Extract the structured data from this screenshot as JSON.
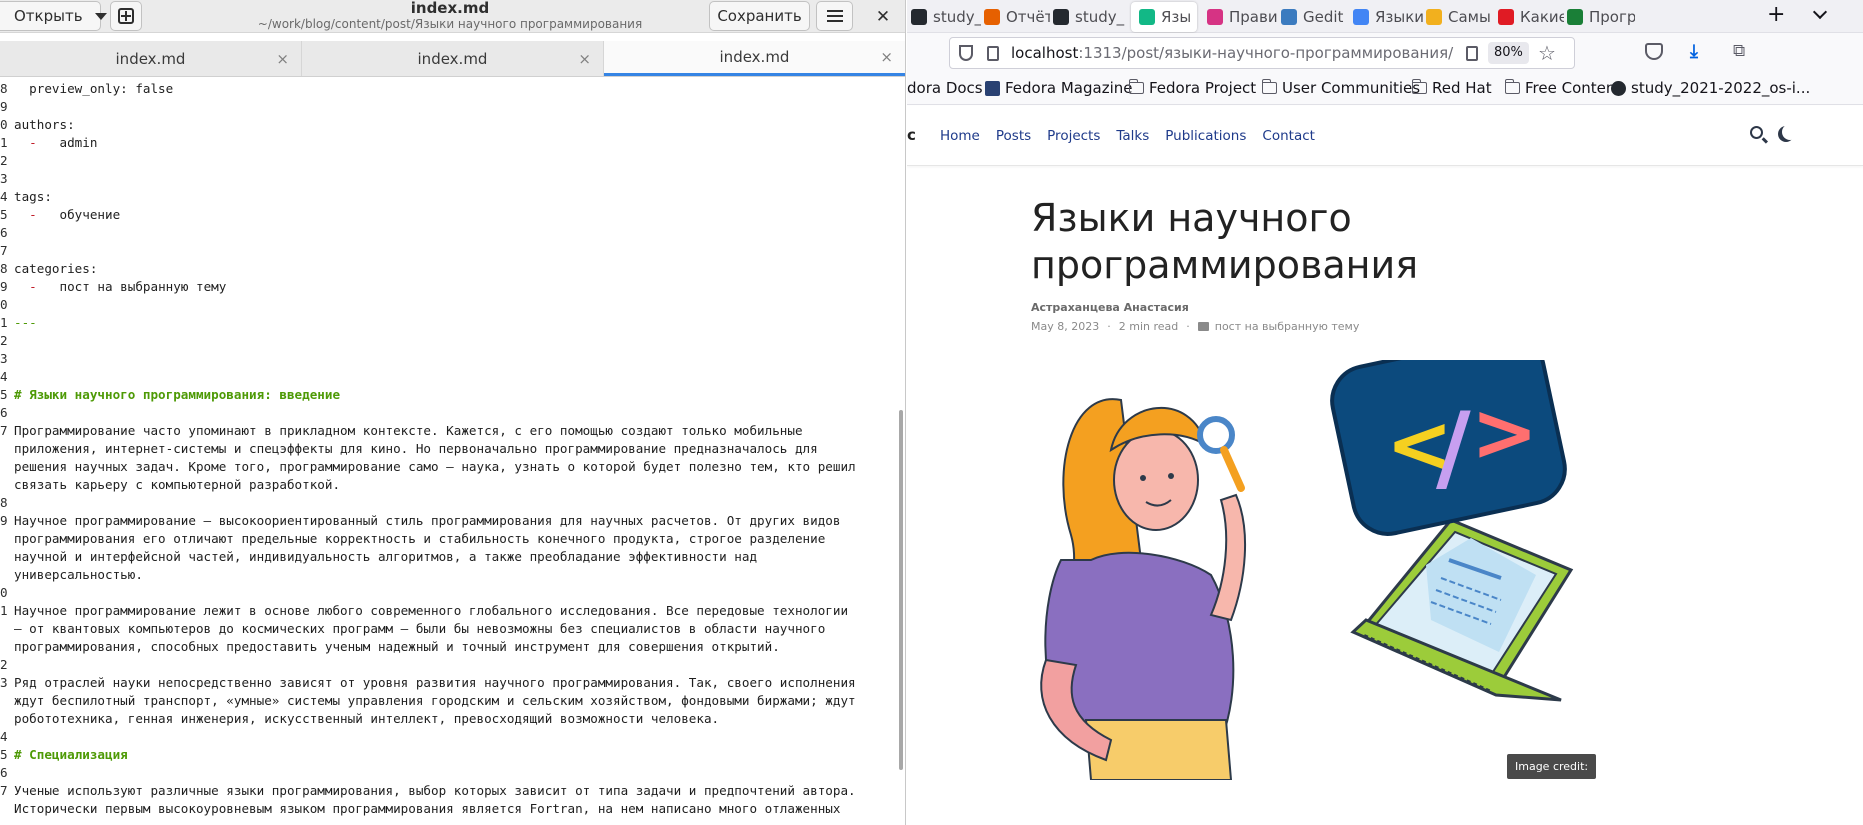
{
  "gedit": {
    "open_label": "Открыть",
    "title": "index.md",
    "subtitle": "~/work/blog/content/post/Языки научного программирования",
    "save_label": "Сохранить",
    "close_glyph": "✕",
    "tabs": [
      {
        "label": "index.md",
        "close": "×"
      },
      {
        "label": "index.md",
        "close": "×"
      },
      {
        "label": "index.md",
        "close": "×"
      }
    ],
    "lines": [
      {
        "n": "8",
        "t": "  preview_only: false"
      },
      {
        "n": "9",
        "t": ""
      },
      {
        "n": "0",
        "t": "authors:"
      },
      {
        "n": "1",
        "t": "  admin",
        "dash": "- "
      },
      {
        "n": "2",
        "t": ""
      },
      {
        "n": "3",
        "t": ""
      },
      {
        "n": "4",
        "t": "tags:"
      },
      {
        "n": "5",
        "t": "  обучение",
        "dash": "- "
      },
      {
        "n": "6",
        "t": ""
      },
      {
        "n": "7",
        "t": ""
      },
      {
        "n": "8",
        "t": "categories:"
      },
      {
        "n": "9",
        "t": "  пост на выбранную тему",
        "dash": "- "
      },
      {
        "n": "0",
        "t": ""
      },
      {
        "n": "1",
        "t": "---",
        "sep": true
      },
      {
        "n": "2",
        "t": ""
      },
      {
        "n": "3",
        "t": ""
      },
      {
        "n": "4",
        "t": ""
      },
      {
        "n": "5",
        "t": "# Языки научного программирования: введение",
        "heading": true
      },
      {
        "n": "6",
        "t": ""
      },
      {
        "n": "7",
        "t": "Программирование часто упоминают в прикладном контексте. Кажется, с его помощью создают только мобильные"
      },
      {
        "n": "",
        "t": "приложения, интернет-системы и спецэффекты для кино. Но первоначально программирование предназначалось для"
      },
      {
        "n": "",
        "t": "решения научных задач. Кроме того, программирование само — наука, узнать о которой будет полезно тем, кто решил"
      },
      {
        "n": "",
        "t": "связать карьеру с компьютерной разработкой."
      },
      {
        "n": "8",
        "t": ""
      },
      {
        "n": "9",
        "t": "Научное программирование — высокоориентированный стиль программирования для научных расчетов. От других видов"
      },
      {
        "n": "",
        "t": "программирования его отличают предельные корректность и стабильность конечного продукта, строгое разделение"
      },
      {
        "n": "",
        "t": "научной и интерфейсной частей, индивидуальность алгоритмов, а также преобладание эффективности над"
      },
      {
        "n": "",
        "t": "универсальностью."
      },
      {
        "n": "0",
        "t": ""
      },
      {
        "n": "1",
        "t": "Научное программирование лежит в основе любого современного глобального исследования. Все передовые технологии"
      },
      {
        "n": "",
        "t": "— от квантовых компьютеров до космических программ — были бы невозможны без специалистов в области научного"
      },
      {
        "n": "",
        "t": "программирования, способных предоставить ученым надежный и точный инструмент для совершения открытий."
      },
      {
        "n": "2",
        "t": ""
      },
      {
        "n": "3",
        "t": "Ряд отраслей науки непосредственно зависят от уровня развития научного программирования. Так, своего исполнения"
      },
      {
        "n": "",
        "t": "ждут беспилотный транспорт, «умные» системы управления городским и сельским хозяйством, фондовыми биржами; ждут"
      },
      {
        "n": "",
        "t": "робототехника, генная инженерия, искусственный интеллект, превосходящий возможности человека."
      },
      {
        "n": "4",
        "t": ""
      },
      {
        "n": "5",
        "t": "# Специализация",
        "heading": true
      },
      {
        "n": "6",
        "t": ""
      },
      {
        "n": "7",
        "t": "Ученые используют различные языки программирования, выбор которых зависит от типа задачи и предпочтений автора."
      },
      {
        "n": "",
        "t": "Исторически первым высокоуровневым языком программирования является Fortran, на нем написано много отлаженных"
      }
    ]
  },
  "firefox": {
    "tabs": [
      {
        "label": "study_",
        "icon": "github-icon",
        "color": "#24292f"
      },
      {
        "label": "Отчёт",
        "icon": "m-icon",
        "color": "#e66000"
      },
      {
        "label": "study_",
        "icon": "github-icon",
        "color": "#24292f"
      },
      {
        "label": "Язы",
        "icon": "hugo-icon",
        "color": "#12b886",
        "active": true
      },
      {
        "label": "Прави",
        "icon": "feather-icon",
        "color": "#d63384"
      },
      {
        "label": "Gedit",
        "icon": "gedit-icon",
        "color": "#3b7bbf"
      },
      {
        "label": "Языки",
        "icon": "google-icon",
        "color": "#4285f4"
      },
      {
        "label": "Самы",
        "icon": "play-icon",
        "color": "#f2b01e"
      },
      {
        "label": "Какие",
        "icon": "red-square-icon",
        "color": "#e01b24"
      },
      {
        "label": "Прогр",
        "icon": "nk-icon",
        "color": "#1a7f37"
      }
    ],
    "tab_close": "✕",
    "new_tab": "+",
    "url_host": "localhost",
    "url_path": ":1313/post/языки-научного-программирования/",
    "zoom": "80%",
    "star": "☆",
    "download": "⤓",
    "extensions": "⧉",
    "bookmarks": [
      {
        "label": "dora Docs",
        "kind": "none"
      },
      {
        "label": "Fedora Magazine",
        "kind": "fedora"
      },
      {
        "label": "Fedora Project",
        "kind": "folder"
      },
      {
        "label": "User Communities",
        "kind": "folder"
      },
      {
        "label": "Red Hat",
        "kind": "folder"
      },
      {
        "label": "Free Content",
        "kind": "folder"
      },
      {
        "label": "study_2021-2022_os-i...",
        "kind": "github"
      }
    ]
  },
  "site": {
    "logo": "c",
    "nav": [
      "Home",
      "Posts",
      "Projects",
      "Talks",
      "Publications",
      "Contact"
    ],
    "title_line1": "Языки научного",
    "title_line2": "программирования",
    "author": "Астраханцева Анастасия",
    "date": "May 8, 2023",
    "read_time": "2 min read",
    "category": "пост на выбранную тему",
    "meta_dot": "·",
    "image_credit": "Image credit:",
    "code_symbol_left": "<",
    "code_symbol_slash": "/",
    "code_symbol_right": ">"
  },
  "colors": {
    "accent_blue": "#3584e4",
    "heading_green": "#4e9a06",
    "dash_red": "#c01c28",
    "nav_link": "#1e3a8a"
  }
}
